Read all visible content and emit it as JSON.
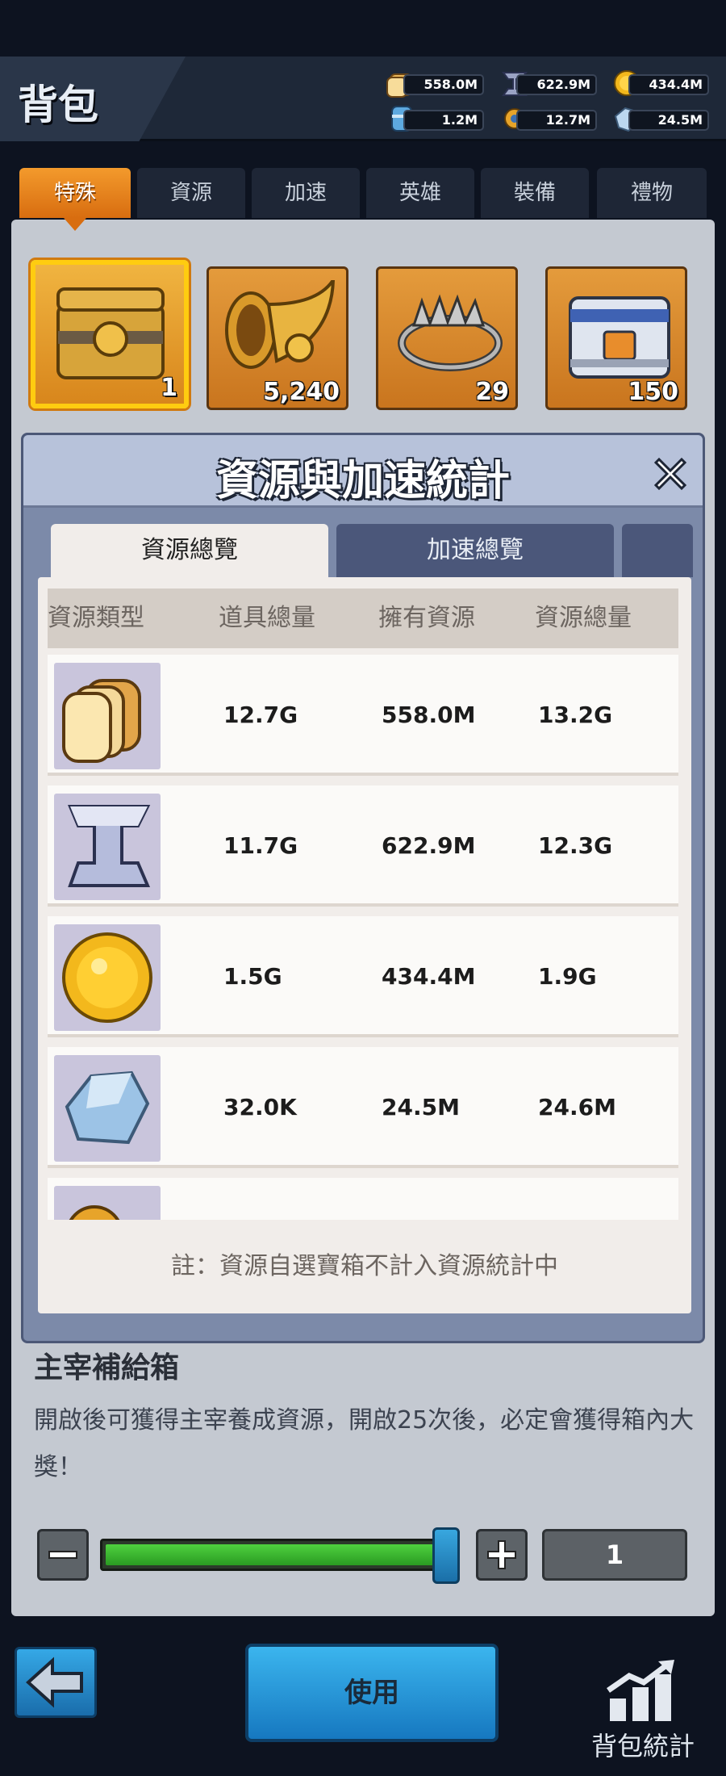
{
  "header": {
    "title": "背包",
    "resources": [
      {
        "icon": "bread-icon",
        "value": "558.0M"
      },
      {
        "icon": "iron-icon",
        "value": "622.9M"
      },
      {
        "icon": "gold-coin-icon",
        "value": "434.4M"
      },
      {
        "icon": "water-barrel-icon",
        "value": "1.2M"
      },
      {
        "icon": "gear-tool-icon",
        "value": "12.7M"
      },
      {
        "icon": "crystal-icon",
        "value": "24.5M"
      }
    ]
  },
  "tabs": [
    "特殊",
    "資源",
    "加速",
    "英雄",
    "裝備",
    "禮物"
  ],
  "active_tab": "特殊",
  "items": [
    {
      "icon": "treasure-chest-icon",
      "count": "1"
    },
    {
      "icon": "horn-icon",
      "count": "5,240"
    },
    {
      "icon": "trap-icon",
      "count": "29"
    },
    {
      "icon": "supply-crate-icon",
      "count": "150"
    }
  ],
  "modal": {
    "title": "資源與加速統計",
    "tabs": [
      "資源總覽",
      "加速總覽"
    ],
    "columns": [
      "資源類型",
      "道具總量",
      "擁有資源",
      "資源總量"
    ],
    "rows": [
      {
        "icon": "bread-icon",
        "items_total": "12.7G",
        "owned": "558.0M",
        "total": "13.2G"
      },
      {
        "icon": "iron-icon",
        "items_total": "11.7G",
        "owned": "622.9M",
        "total": "12.3G"
      },
      {
        "icon": "gold-coin-icon",
        "items_total": "1.5G",
        "owned": "434.4M",
        "total": "1.9G"
      },
      {
        "icon": "crystal-icon",
        "items_total": "32.0K",
        "owned": "24.5M",
        "total": "24.6M"
      }
    ],
    "note": "註：資源自選寶箱不計入資源統計中"
  },
  "item_detail": {
    "name": "主宰補給箱",
    "description": "開啟後可獲得主宰養成資源，開啟25次後，必定會獲得箱內大獎！"
  },
  "quantity": {
    "value": "1",
    "slider_fraction": 1.0
  },
  "footer": {
    "use_label": "使用",
    "stats_label": "背包統計"
  }
}
